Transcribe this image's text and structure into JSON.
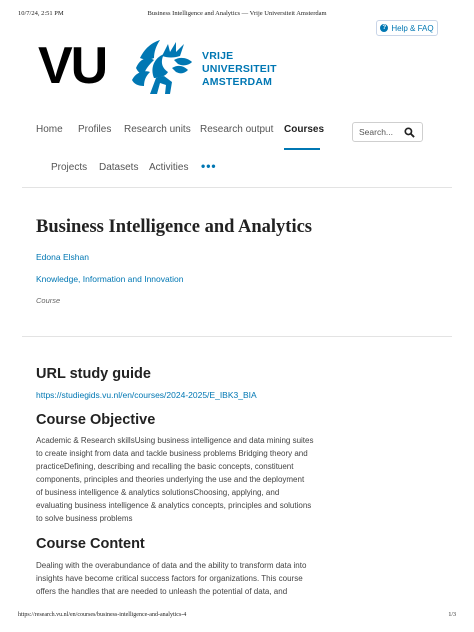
{
  "print_header": {
    "datetime": "10/7/24, 2:51 PM",
    "title": "Business Intelligence and Analytics — Vrije Universiteit Amsterdam"
  },
  "help": {
    "label": "Help & FAQ",
    "icon": "question-circle-icon"
  },
  "logo": {
    "letters": "VU",
    "line1": "VRIJE",
    "line2": "UNIVERSITEIT",
    "line3": "AMSTERDAM",
    "brand_color": "#0077b3"
  },
  "nav": {
    "items": [
      "Home",
      "Profiles",
      "Research units",
      "Research output",
      "Courses"
    ],
    "active": "Courses",
    "sub_items": [
      "Projects",
      "Datasets",
      "Activities"
    ],
    "more_label": "•••"
  },
  "search": {
    "placeholder": "Search...",
    "icon": "search-icon"
  },
  "course": {
    "title": "Business Intelligence and Analytics",
    "person": "Edona Elshan",
    "unit": "Knowledge, Information and Innovation",
    "type": "Course"
  },
  "sections": {
    "url_heading": "URL study guide",
    "url_link": "https://studiegids.vu.nl/en/courses/2024-2025/E_IBK3_BIA",
    "objective_heading": "Course Objective",
    "objective_lines": [
      "Academic & Research skillsUsing business intelligence and data mining suites",
      "to create insight from data and tackle business problems Bridging theory and",
      "practiceDefining, describing and recalling the basic concepts, constituent",
      "components, principles and theories underlying the use and the deployment",
      "of business intelligence & analytics solutionsChoosing, applying, and",
      "evaluating business intelligence & analytics concepts, principles and solutions",
      "to solve business problems"
    ],
    "content_heading": "Course Content",
    "content_lines": [
      "Dealing with the overabundance of data and the ability to transform data into",
      "insights have become critical success factors for organizations. This course",
      "offers the handles that are needed to unleash the potential of data, and"
    ]
  },
  "print_footer": {
    "url": "https://research.vu.nl/en/courses/business-intelligence-and-analytics-4",
    "page": "1/3"
  }
}
